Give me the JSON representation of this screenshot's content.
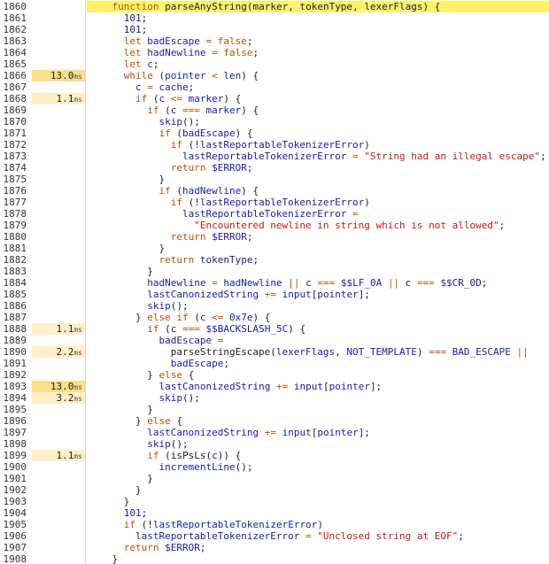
{
  "colors": {
    "keyword": "#b35400",
    "number": "#1a1aa6",
    "string": "#c41a16",
    "identifier": "#1a1aa6",
    "plain": "#222222",
    "current_line_bg": "#fcf26b",
    "timing_hot_bg": "#fbdf8a",
    "timing_warm_bg": "#fdf0c6"
  },
  "lines": [
    {
      "num": "1860",
      "time": "",
      "unit": "",
      "current": true,
      "tokens": [
        {
          "t": "    "
        },
        {
          "t": "function",
          "c": "kw"
        },
        {
          "t": " parseAnyString"
        },
        {
          "t": "("
        },
        {
          "t": "marker",
          "c": "plain"
        },
        {
          "t": ", "
        },
        {
          "t": "tokenType"
        },
        {
          "t": ", "
        },
        {
          "t": "lexerFlags"
        },
        {
          "t": ")"
        },
        {
          "t": " {"
        }
      ]
    },
    {
      "num": "1861",
      "time": "",
      "unit": "",
      "tokens": [
        {
          "t": "      "
        },
        {
          "t": "101",
          "c": "num"
        },
        {
          "t": ";"
        }
      ]
    },
    {
      "num": "1862",
      "time": "",
      "unit": "",
      "tokens": [
        {
          "t": "      "
        },
        {
          "t": "101",
          "c": "num"
        },
        {
          "t": ";"
        }
      ]
    },
    {
      "num": "1863",
      "time": "",
      "unit": "",
      "tokens": [
        {
          "t": "      "
        },
        {
          "t": "let",
          "c": "kw"
        },
        {
          "t": " "
        },
        {
          "t": "badEscape",
          "c": "var"
        },
        {
          "t": " "
        },
        {
          "t": "=",
          "c": "op"
        },
        {
          "t": " "
        },
        {
          "t": "false",
          "c": "kw"
        },
        {
          "t": ";"
        }
      ]
    },
    {
      "num": "1864",
      "time": "",
      "unit": "",
      "tokens": [
        {
          "t": "      "
        },
        {
          "t": "let",
          "c": "kw"
        },
        {
          "t": " "
        },
        {
          "t": "hadNewline",
          "c": "var"
        },
        {
          "t": " "
        },
        {
          "t": "=",
          "c": "op"
        },
        {
          "t": " "
        },
        {
          "t": "false",
          "c": "kw"
        },
        {
          "t": ";"
        }
      ]
    },
    {
      "num": "1865",
      "time": "",
      "unit": "",
      "tokens": [
        {
          "t": "      "
        },
        {
          "t": "let",
          "c": "kw"
        },
        {
          "t": " "
        },
        {
          "t": "c",
          "c": "var"
        },
        {
          "t": ";"
        }
      ]
    },
    {
      "num": "1866",
      "time": "13.0",
      "unit": "ms",
      "heat": "hot",
      "tokens": [
        {
          "t": "      "
        },
        {
          "t": "while",
          "c": "kw"
        },
        {
          "t": " ("
        },
        {
          "t": "pointer",
          "c": "var"
        },
        {
          "t": " "
        },
        {
          "t": "<",
          "c": "op"
        },
        {
          "t": " "
        },
        {
          "t": "len",
          "c": "var"
        },
        {
          "t": ") {"
        }
      ]
    },
    {
      "num": "1867",
      "time": "",
      "unit": "",
      "tokens": [
        {
          "t": "        "
        },
        {
          "t": "c",
          "c": "var"
        },
        {
          "t": " "
        },
        {
          "t": "=",
          "c": "op"
        },
        {
          "t": " "
        },
        {
          "t": "cache",
          "c": "var"
        },
        {
          "t": ";"
        }
      ]
    },
    {
      "num": "1868",
      "time": "1.1",
      "unit": "ms",
      "heat": "warm",
      "tokens": [
        {
          "t": "        "
        },
        {
          "t": "if",
          "c": "kw"
        },
        {
          "t": " ("
        },
        {
          "t": "c",
          "c": "var"
        },
        {
          "t": " "
        },
        {
          "t": "<=",
          "c": "op"
        },
        {
          "t": " "
        },
        {
          "t": "marker",
          "c": "var"
        },
        {
          "t": ") {"
        }
      ]
    },
    {
      "num": "1869",
      "time": "",
      "unit": "",
      "tokens": [
        {
          "t": "          "
        },
        {
          "t": "if",
          "c": "kw"
        },
        {
          "t": " ("
        },
        {
          "t": "c",
          "c": "var"
        },
        {
          "t": " "
        },
        {
          "t": "===",
          "c": "op"
        },
        {
          "t": " "
        },
        {
          "t": "marker",
          "c": "var"
        },
        {
          "t": ") {"
        }
      ]
    },
    {
      "num": "1870",
      "time": "",
      "unit": "",
      "tokens": [
        {
          "t": "            "
        },
        {
          "t": "skip",
          "c": "var"
        },
        {
          "t": "();"
        }
      ]
    },
    {
      "num": "1871",
      "time": "",
      "unit": "",
      "tokens": [
        {
          "t": "            "
        },
        {
          "t": "if",
          "c": "kw"
        },
        {
          "t": " ("
        },
        {
          "t": "badEscape",
          "c": "var"
        },
        {
          "t": ") {"
        }
      ]
    },
    {
      "num": "1872",
      "time": "",
      "unit": "",
      "tokens": [
        {
          "t": "              "
        },
        {
          "t": "if",
          "c": "kw"
        },
        {
          "t": " (!"
        },
        {
          "t": "lastReportableTokenizerError",
          "c": "var"
        },
        {
          "t": ")"
        }
      ]
    },
    {
      "num": "1873",
      "time": "",
      "unit": "",
      "tokens": [
        {
          "t": "                "
        },
        {
          "t": "lastReportableTokenizerError",
          "c": "var"
        },
        {
          "t": " "
        },
        {
          "t": "=",
          "c": "op"
        },
        {
          "t": " "
        },
        {
          "t": "\"String had an illegal escape\"",
          "c": "str"
        },
        {
          "t": ";"
        }
      ]
    },
    {
      "num": "1874",
      "time": "",
      "unit": "",
      "tokens": [
        {
          "t": "              "
        },
        {
          "t": "return",
          "c": "kw"
        },
        {
          "t": " "
        },
        {
          "t": "$ERROR",
          "c": "var"
        },
        {
          "t": ";"
        }
      ]
    },
    {
      "num": "1875",
      "time": "",
      "unit": "",
      "tokens": [
        {
          "t": "            }"
        }
      ]
    },
    {
      "num": "1876",
      "time": "",
      "unit": "",
      "tokens": [
        {
          "t": "            "
        },
        {
          "t": "if",
          "c": "kw"
        },
        {
          "t": " ("
        },
        {
          "t": "hadNewline",
          "c": "var"
        },
        {
          "t": ") {"
        }
      ]
    },
    {
      "num": "1877",
      "time": "",
      "unit": "",
      "tokens": [
        {
          "t": "              "
        },
        {
          "t": "if",
          "c": "kw"
        },
        {
          "t": " (!"
        },
        {
          "t": "lastReportableTokenizerError",
          "c": "var"
        },
        {
          "t": ")"
        }
      ]
    },
    {
      "num": "1878",
      "time": "",
      "unit": "",
      "tokens": [
        {
          "t": "                "
        },
        {
          "t": "lastReportableTokenizerError",
          "c": "var"
        },
        {
          "t": " "
        },
        {
          "t": "=",
          "c": "op"
        }
      ]
    },
    {
      "num": "1879",
      "time": "",
      "unit": "",
      "tokens": [
        {
          "t": "                  "
        },
        {
          "t": "\"Encountered newline in string which is not allowed\"",
          "c": "str"
        },
        {
          "t": ";"
        }
      ]
    },
    {
      "num": "1880",
      "time": "",
      "unit": "",
      "tokens": [
        {
          "t": "              "
        },
        {
          "t": "return",
          "c": "kw"
        },
        {
          "t": " "
        },
        {
          "t": "$ERROR",
          "c": "var"
        },
        {
          "t": ";"
        }
      ]
    },
    {
      "num": "1881",
      "time": "",
      "unit": "",
      "tokens": [
        {
          "t": "            }"
        }
      ]
    },
    {
      "num": "1882",
      "time": "",
      "unit": "",
      "tokens": [
        {
          "t": "            "
        },
        {
          "t": "return",
          "c": "kw"
        },
        {
          "t": " "
        },
        {
          "t": "tokenType",
          "c": "var"
        },
        {
          "t": ";"
        }
      ]
    },
    {
      "num": "1883",
      "time": "",
      "unit": "",
      "tokens": [
        {
          "t": "          }"
        }
      ]
    },
    {
      "num": "1884",
      "time": "",
      "unit": "",
      "tokens": [
        {
          "t": "          "
        },
        {
          "t": "hadNewline",
          "c": "var"
        },
        {
          "t": " "
        },
        {
          "t": "=",
          "c": "op"
        },
        {
          "t": " "
        },
        {
          "t": "hadNewline",
          "c": "var"
        },
        {
          "t": " "
        },
        {
          "t": "||",
          "c": "op"
        },
        {
          "t": " "
        },
        {
          "t": "c",
          "c": "var"
        },
        {
          "t": " "
        },
        {
          "t": "===",
          "c": "op"
        },
        {
          "t": " "
        },
        {
          "t": "$$LF_0A",
          "c": "var"
        },
        {
          "t": " "
        },
        {
          "t": "||",
          "c": "op"
        },
        {
          "t": " "
        },
        {
          "t": "c",
          "c": "var"
        },
        {
          "t": " "
        },
        {
          "t": "===",
          "c": "op"
        },
        {
          "t": " "
        },
        {
          "t": "$$CR_0D",
          "c": "var"
        },
        {
          "t": ";"
        }
      ]
    },
    {
      "num": "1885",
      "time": "",
      "unit": "",
      "tokens": [
        {
          "t": "          "
        },
        {
          "t": "lastCanonizedString",
          "c": "var"
        },
        {
          "t": " "
        },
        {
          "t": "+=",
          "c": "op"
        },
        {
          "t": " "
        },
        {
          "t": "input",
          "c": "var"
        },
        {
          "t": "["
        },
        {
          "t": "pointer",
          "c": "var"
        },
        {
          "t": "];"
        }
      ]
    },
    {
      "num": "1886",
      "time": "",
      "unit": "",
      "tokens": [
        {
          "t": "          "
        },
        {
          "t": "skip",
          "c": "var"
        },
        {
          "t": "();"
        }
      ]
    },
    {
      "num": "1887",
      "time": "",
      "unit": "",
      "tokens": [
        {
          "t": "        } "
        },
        {
          "t": "else",
          "c": "kw"
        },
        {
          "t": " "
        },
        {
          "t": "if",
          "c": "kw"
        },
        {
          "t": " ("
        },
        {
          "t": "c",
          "c": "var"
        },
        {
          "t": " "
        },
        {
          "t": "<=",
          "c": "op"
        },
        {
          "t": " "
        },
        {
          "t": "0x7e",
          "c": "num"
        },
        {
          "t": ") {"
        }
      ]
    },
    {
      "num": "1888",
      "time": "1.1",
      "unit": "ms",
      "heat": "warm",
      "tokens": [
        {
          "t": "          "
        },
        {
          "t": "if",
          "c": "kw"
        },
        {
          "t": " ("
        },
        {
          "t": "c",
          "c": "var"
        },
        {
          "t": " "
        },
        {
          "t": "===",
          "c": "op"
        },
        {
          "t": " "
        },
        {
          "t": "$$BACKSLASH_5C",
          "c": "var"
        },
        {
          "t": ") {"
        }
      ]
    },
    {
      "num": "1889",
      "time": "",
      "unit": "",
      "tokens": [
        {
          "t": "            "
        },
        {
          "t": "badEscape",
          "c": "var"
        },
        {
          "t": " "
        },
        {
          "t": "=",
          "c": "op"
        }
      ]
    },
    {
      "num": "1890",
      "time": "2.2",
      "unit": "ms",
      "heat": "warm",
      "tokens": [
        {
          "t": "              parseStringEscape("
        },
        {
          "t": "lexerFlags",
          "c": "var"
        },
        {
          "t": ", "
        },
        {
          "t": "NOT_TEMPLATE",
          "c": "var"
        },
        {
          "t": ") "
        },
        {
          "t": "===",
          "c": "op"
        },
        {
          "t": " "
        },
        {
          "t": "BAD_ESCAPE",
          "c": "var"
        },
        {
          "t": " "
        },
        {
          "t": "||",
          "c": "op"
        }
      ]
    },
    {
      "num": "1891",
      "time": "",
      "unit": "",
      "tokens": [
        {
          "t": "              "
        },
        {
          "t": "badEscape",
          "c": "var"
        },
        {
          "t": ";"
        }
      ]
    },
    {
      "num": "1892",
      "time": "",
      "unit": "",
      "tokens": [
        {
          "t": "          } "
        },
        {
          "t": "else",
          "c": "kw"
        },
        {
          "t": " {"
        }
      ]
    },
    {
      "num": "1893",
      "time": "13.0",
      "unit": "ms",
      "heat": "hot",
      "tokens": [
        {
          "t": "            "
        },
        {
          "t": "lastCanonizedString",
          "c": "var"
        },
        {
          "t": " "
        },
        {
          "t": "+=",
          "c": "op"
        },
        {
          "t": " "
        },
        {
          "t": "input",
          "c": "var"
        },
        {
          "t": "["
        },
        {
          "t": "pointer",
          "c": "var"
        },
        {
          "t": "];"
        }
      ]
    },
    {
      "num": "1894",
      "time": "3.2",
      "unit": "ms",
      "heat": "warm",
      "tokens": [
        {
          "t": "            "
        },
        {
          "t": "skip",
          "c": "var"
        },
        {
          "t": "();"
        }
      ]
    },
    {
      "num": "1895",
      "time": "",
      "unit": "",
      "tokens": [
        {
          "t": "          }"
        }
      ]
    },
    {
      "num": "1896",
      "time": "",
      "unit": "",
      "tokens": [
        {
          "t": "        } "
        },
        {
          "t": "else",
          "c": "kw"
        },
        {
          "t": " {"
        }
      ]
    },
    {
      "num": "1897",
      "time": "",
      "unit": "",
      "tokens": [
        {
          "t": "          "
        },
        {
          "t": "lastCanonizedString",
          "c": "var"
        },
        {
          "t": " "
        },
        {
          "t": "+=",
          "c": "op"
        },
        {
          "t": " "
        },
        {
          "t": "input",
          "c": "var"
        },
        {
          "t": "["
        },
        {
          "t": "pointer",
          "c": "var"
        },
        {
          "t": "];"
        }
      ]
    },
    {
      "num": "1898",
      "time": "",
      "unit": "",
      "tokens": [
        {
          "t": "          "
        },
        {
          "t": "skip",
          "c": "var"
        },
        {
          "t": "();"
        }
      ]
    },
    {
      "num": "1899",
      "time": "1.1",
      "unit": "ms",
      "heat": "warm",
      "tokens": [
        {
          "t": "          "
        },
        {
          "t": "if",
          "c": "kw"
        },
        {
          "t": " (isPsLs("
        },
        {
          "t": "c",
          "c": "var"
        },
        {
          "t": ")) {"
        }
      ]
    },
    {
      "num": "1900",
      "time": "",
      "unit": "",
      "tokens": [
        {
          "t": "            "
        },
        {
          "t": "incrementLine",
          "c": "var"
        },
        {
          "t": "();"
        }
      ]
    },
    {
      "num": "1901",
      "time": "",
      "unit": "",
      "tokens": [
        {
          "t": "          }"
        }
      ]
    },
    {
      "num": "1902",
      "time": "",
      "unit": "",
      "tokens": [
        {
          "t": "        }"
        }
      ]
    },
    {
      "num": "1903",
      "time": "",
      "unit": "",
      "tokens": [
        {
          "t": "      }"
        }
      ]
    },
    {
      "num": "1904",
      "time": "",
      "unit": "",
      "tokens": [
        {
          "t": "      "
        },
        {
          "t": "101",
          "c": "num"
        },
        {
          "t": ";"
        }
      ]
    },
    {
      "num": "1905",
      "time": "",
      "unit": "",
      "tokens": [
        {
          "t": "      "
        },
        {
          "t": "if",
          "c": "kw"
        },
        {
          "t": " (!"
        },
        {
          "t": "lastReportableTokenizerError",
          "c": "var"
        },
        {
          "t": ")"
        }
      ]
    },
    {
      "num": "1906",
      "time": "",
      "unit": "",
      "tokens": [
        {
          "t": "        "
        },
        {
          "t": "lastReportableTokenizerError",
          "c": "var"
        },
        {
          "t": " "
        },
        {
          "t": "=",
          "c": "op"
        },
        {
          "t": " "
        },
        {
          "t": "\"Unclosed string at EOF\"",
          "c": "str"
        },
        {
          "t": ";"
        }
      ]
    },
    {
      "num": "1907",
      "time": "",
      "unit": "",
      "tokens": [
        {
          "t": "      "
        },
        {
          "t": "return",
          "c": "kw"
        },
        {
          "t": " "
        },
        {
          "t": "$ERROR",
          "c": "var"
        },
        {
          "t": ";"
        }
      ]
    },
    {
      "num": "1908",
      "time": "",
      "unit": "",
      "tokens": [
        {
          "t": "    }"
        }
      ]
    }
  ]
}
